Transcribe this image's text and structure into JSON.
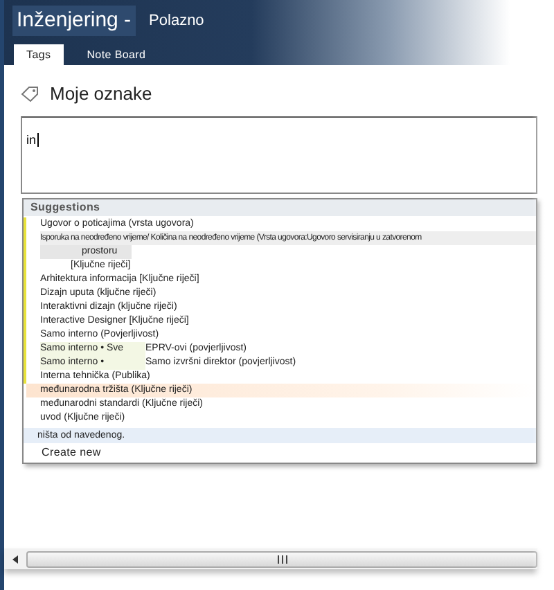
{
  "header": {
    "site_title": "Inženjering -",
    "link": "Polazno"
  },
  "tabs": [
    {
      "label": "Tags",
      "selected": true
    },
    {
      "label": "Note Board",
      "selected": false
    }
  ],
  "heading": "Moje oznake",
  "tag_field": {
    "value": "in"
  },
  "suggestions": {
    "title": "Suggestions",
    "items": [
      {
        "parts": [
          "Ugovor o poticajima (vrsta ugovora)"
        ],
        "marked": true,
        "selected": false
      },
      {
        "parts": [
          "Isporuka na neodređeno vrijeme/ Količina na neodređeno vrijeme (Vrsta ugovora:Ugovoro servisiranju u zatvorenom",
          "prostoru",
          "[Ključne riječi]"
        ],
        "marked": true,
        "selected": false,
        "kind": "wrapped"
      },
      {
        "parts": [
          "Arhitektura informacija [Ključne riječi]"
        ],
        "marked": true,
        "selected": false
      },
      {
        "parts": [
          "Dizajn uputa (ključne riječi)"
        ],
        "marked": true,
        "selected": false
      },
      {
        "parts": [
          "Interaktivni dizajn (ključne riječi)"
        ],
        "marked": true,
        "selected": false
      },
      {
        "parts": [
          "Interactive Designer [Ključne riječi]"
        ],
        "marked": true,
        "selected": false
      },
      {
        "parts": [
          "Samo interno (Povjerljivost)"
        ],
        "marked": true,
        "selected": false
      },
      {
        "parts": [
          "Samo interno • Sve",
          "EPRV-ovi (povjerljivost)"
        ],
        "marked": true,
        "selected": false
      },
      {
        "parts": [
          "Samo interno •",
          "Samo izvršni direktor (povjerljivost)"
        ],
        "marked": true,
        "selected": false
      },
      {
        "parts": [
          "Interna tehnička (Publika)"
        ],
        "marked": true,
        "selected": false
      },
      {
        "parts": [
          "međunarodna tržišta (Ključne riječi)"
        ],
        "marked": false,
        "selected": true
      },
      {
        "parts": [
          "međunarodni standardi (Ključne riječi)"
        ],
        "marked": false,
        "selected": false
      },
      {
        "parts": [
          "uvod (Ključne riječi)"
        ],
        "marked": false,
        "selected": false
      }
    ],
    "none_option": "ništa od navedenog.",
    "create_new": "Create new"
  }
}
